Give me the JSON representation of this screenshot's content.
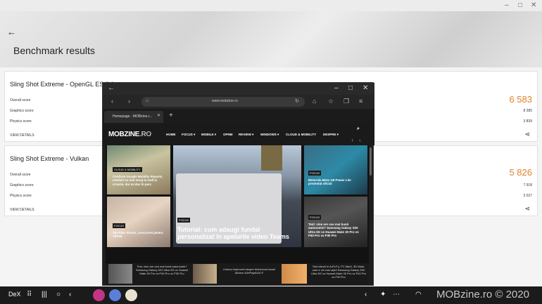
{
  "window": {
    "controls": [
      "–",
      "□",
      "✕"
    ]
  },
  "header": {
    "back_icon": "arrow-left-icon",
    "title": "Benchmark results"
  },
  "tests": [
    {
      "title": "Sling Shot Extreme - OpenGL ES 3.1",
      "overall_label": "Overall score",
      "overall_value": "6 583",
      "graphics_label": "Graphics score",
      "graphics_value": "8 285",
      "physics_label": "Physics score",
      "physics_value": "3 839",
      "details_label": "VIEW DETAILS"
    },
    {
      "title": "Sling Shot Extreme - Vulkan",
      "overall_label": "Overall score",
      "overall_value": "5 826",
      "graphics_label": "Graphics score",
      "graphics_value": "7 918",
      "physics_label": "Physics score",
      "physics_value": "3 027",
      "details_label": "VIEW DETAILS"
    }
  ],
  "browser": {
    "url": "www.mobzine.ro",
    "tab_label": "Homepage - MOBzine.r...",
    "site": {
      "logo_main": "MOBZINE",
      "logo_suffix": ".RO",
      "menu": [
        "HOME",
        "FOCUS ▾",
        "MOBILE ▾",
        "OPINII",
        "REVIEW ▾",
        "WINDOWS ▾",
        "CLOUD & MOBILITY",
        "DESPRE ▾"
      ],
      "tiles": [
        {
          "tag": "CLOUD & MOBILITY",
          "caption": "Conform Google Mobility Reports, românii nu mai merg la mall și croazie, dar se duc în parc"
        },
        {
          "tag": "FOCUS",
          "caption": "YouTube Shorts, concurent pentru TikTok"
        },
        {
          "tag": "FOCUS",
          "caption": "Tutorial: cum adaugi fundal personalizat în apelurile video Teams"
        },
        {
          "tag": "FOCUS",
          "caption": "Motorola Moto G8 Power Lite prezentat oficial"
        },
        {
          "tag": "FOCUS",
          "caption": "Test: cine are cea mai bună autonomie? Samsung Galaxy S20 Ultra 5G vs Huawei Mate 30 Pro vs P40 Pro vs P30 Pro"
        }
      ],
      "strip": [
        "Test: cine are cea mai bună autonomie? Samsung Galaxy S20 Ultra 5G vs Huawei Mate 30 Pro vs P40 Pro vs P30 Pro",
        "Celexa împreună despre televizorul smart Allview 40ePlay6100-F",
        "Test viteză în AnTuTu, PC Mark, 3D Mark: care e cel mai rapid Samsung Galaxy S20 Ultra 5G vs Huawei Mate 30 Pro vs P40 Pro vs P30 Pro"
      ]
    }
  },
  "taskbar": {
    "dex_label": "DeX",
    "watermark": "MOBzine.ro © 2020",
    "app_colors": [
      "#c13584",
      "#5b7fd8",
      "#e9e2d0"
    ]
  },
  "colors": {
    "accent": "#e0822a"
  }
}
